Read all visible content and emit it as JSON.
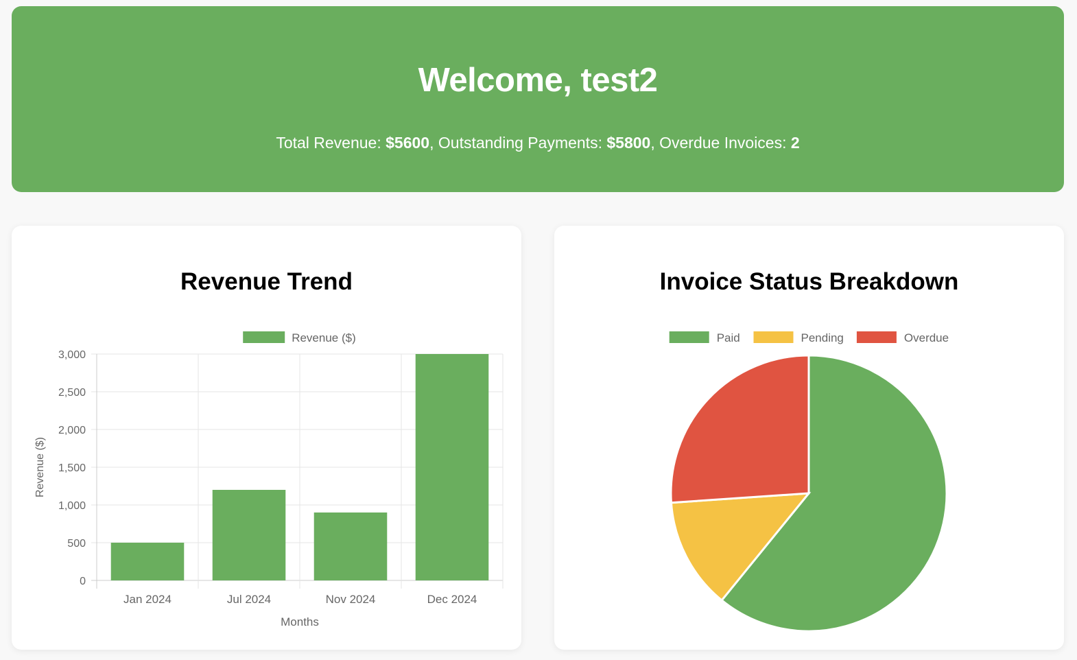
{
  "header": {
    "greeting": "Welcome, test2",
    "revenue_label": "Total Revenue: ",
    "revenue_value": "$5600",
    "sep1": ", ",
    "outstanding_label": "Outstanding Payments: ",
    "outstanding_value": "$5800",
    "sep2": ", ",
    "overdue_label": "Overdue Invoices: ",
    "overdue_value": "2",
    "background": "#6aae5e"
  },
  "revenue_card": {
    "title": "Revenue Trend"
  },
  "status_card": {
    "title": "Invoice Status Breakdown"
  },
  "chart_data": [
    {
      "type": "bar",
      "title": "Revenue Trend",
      "categories": [
        "Jan 2024",
        "Jul 2024",
        "Nov 2024",
        "Dec 2024"
      ],
      "series": [
        {
          "name": "Revenue ($)",
          "values": [
            500,
            1200,
            900,
            3000
          ],
          "color": "#6aae5e"
        }
      ],
      "xlabel": "Months",
      "ylabel": "Revenue ($)",
      "ylim": [
        0,
        3000
      ],
      "yticks": [
        0,
        500,
        1000,
        1500,
        2000,
        2500,
        3000
      ],
      "ytick_labels": [
        "0",
        "500",
        "1,000",
        "1,500",
        "2,000",
        "2,500",
        "3,000"
      ],
      "grid": true,
      "legend": "top"
    },
    {
      "type": "pie",
      "title": "Invoice Status Breakdown",
      "labels": [
        "Paid",
        "Pending",
        "Overdue"
      ],
      "values": [
        5600,
        1200,
        2400
      ],
      "colors": [
        "#6aae5e",
        "#f5c244",
        "#e05441"
      ],
      "legend": "top"
    }
  ]
}
